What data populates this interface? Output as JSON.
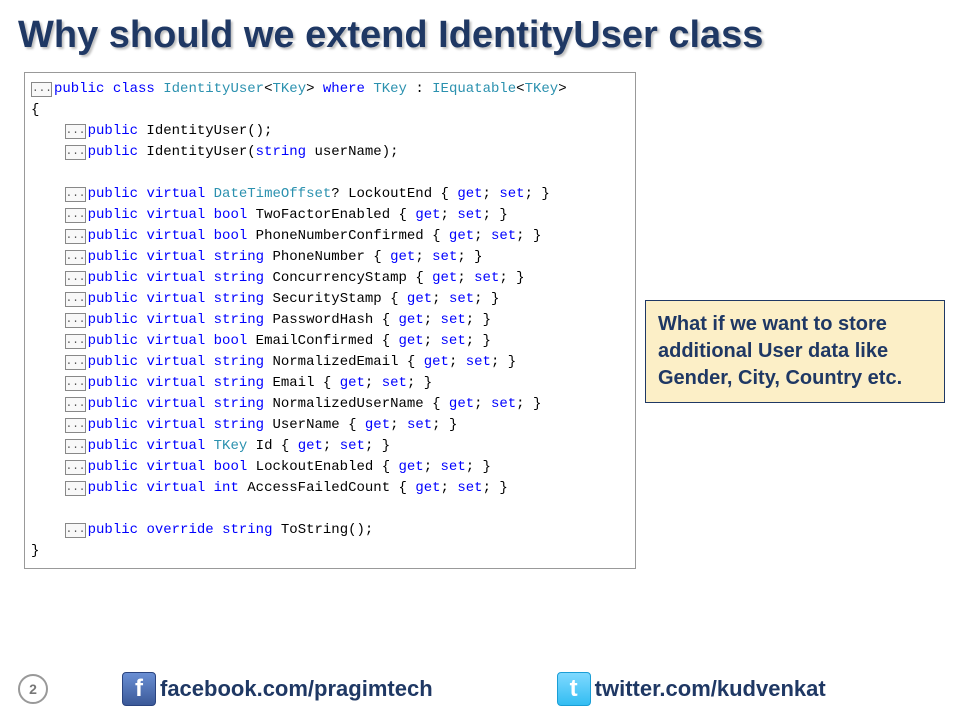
{
  "title": "Why should we extend IdentityUser class",
  "callout": "What if we want to store additional User data like Gender, City, Country etc.",
  "page": "2",
  "social": {
    "fb": "facebook.com/pragimtech",
    "tw": "twitter.com/kudvenkat"
  },
  "code": {
    "ellipsis": "...",
    "open_brace": "{",
    "close_brace": "}",
    "kw_public": "public",
    "kw_class": "class",
    "kw_where": "where",
    "kw_virtual": "virtual",
    "kw_override": "override",
    "kw_get": "get",
    "kw_set": "set",
    "t_IdentityUser": "IdentityUser",
    "t_TKey": "TKey",
    "t_IEquatable": "IEquatable",
    "t_DateTimeOffset": "DateTimeOffset",
    "t_bool": "bool",
    "t_string": "string",
    "t_int": "int",
    "ctor1_sig": " IdentityUser();",
    "ctor2_sig_pre": " IdentityUser(",
    "ctor2_param": " userName);",
    "p_LockoutEnd": "? LockoutEnd ",
    "p_TwoFactorEnabled": " TwoFactorEnabled ",
    "p_PhoneNumberConfirmed": " PhoneNumberConfirmed ",
    "p_PhoneNumber": " PhoneNumber ",
    "p_ConcurrencyStamp": " ConcurrencyStamp ",
    "p_SecurityStamp": " SecurityStamp ",
    "p_PasswordHash": " PasswordHash ",
    "p_EmailConfirmed": " EmailConfirmed ",
    "p_NormalizedEmail": " NormalizedEmail ",
    "p_Email": " Email ",
    "p_NormalizedUserName": " NormalizedUserName ",
    "p_UserName": " UserName ",
    "p_Id": " Id ",
    "p_LockoutEnabled": " LockoutEnabled ",
    "p_AccessFailedCount": " AccessFailedCount ",
    "m_ToString": " ToString();",
    "sp": " ",
    "indent": "    ",
    "semi": "; ",
    "semi_end": "; }",
    "obrace_sp": "{ ",
    "lt": "<",
    "gt": ">",
    "colon": " : "
  }
}
